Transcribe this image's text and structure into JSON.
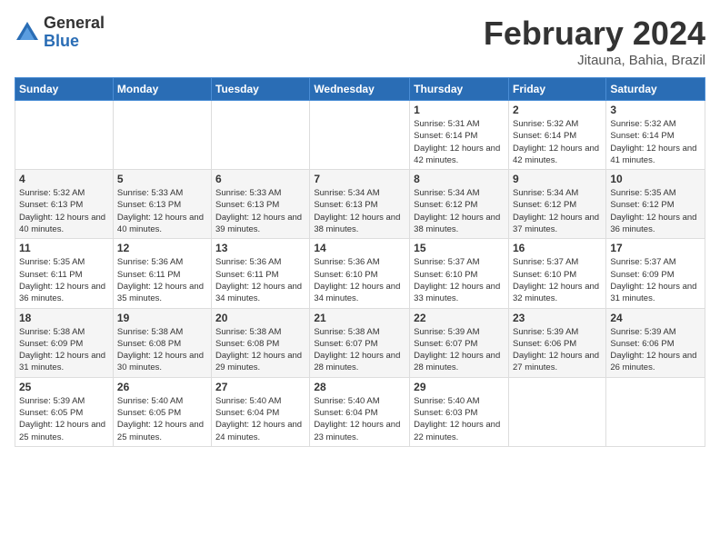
{
  "logo": {
    "general": "General",
    "blue": "Blue"
  },
  "title": "February 2024",
  "location": "Jitauna, Bahia, Brazil",
  "weekdays": [
    "Sunday",
    "Monday",
    "Tuesday",
    "Wednesday",
    "Thursday",
    "Friday",
    "Saturday"
  ],
  "weeks": [
    [
      {
        "day": "",
        "sunrise": "",
        "sunset": "",
        "daylight": ""
      },
      {
        "day": "",
        "sunrise": "",
        "sunset": "",
        "daylight": ""
      },
      {
        "day": "",
        "sunrise": "",
        "sunset": "",
        "daylight": ""
      },
      {
        "day": "",
        "sunrise": "",
        "sunset": "",
        "daylight": ""
      },
      {
        "day": "1",
        "sunrise": "Sunrise: 5:31 AM",
        "sunset": "Sunset: 6:14 PM",
        "daylight": "Daylight: 12 hours and 42 minutes."
      },
      {
        "day": "2",
        "sunrise": "Sunrise: 5:32 AM",
        "sunset": "Sunset: 6:14 PM",
        "daylight": "Daylight: 12 hours and 42 minutes."
      },
      {
        "day": "3",
        "sunrise": "Sunrise: 5:32 AM",
        "sunset": "Sunset: 6:14 PM",
        "daylight": "Daylight: 12 hours and 41 minutes."
      }
    ],
    [
      {
        "day": "4",
        "sunrise": "Sunrise: 5:32 AM",
        "sunset": "Sunset: 6:13 PM",
        "daylight": "Daylight: 12 hours and 40 minutes."
      },
      {
        "day": "5",
        "sunrise": "Sunrise: 5:33 AM",
        "sunset": "Sunset: 6:13 PM",
        "daylight": "Daylight: 12 hours and 40 minutes."
      },
      {
        "day": "6",
        "sunrise": "Sunrise: 5:33 AM",
        "sunset": "Sunset: 6:13 PM",
        "daylight": "Daylight: 12 hours and 39 minutes."
      },
      {
        "day": "7",
        "sunrise": "Sunrise: 5:34 AM",
        "sunset": "Sunset: 6:13 PM",
        "daylight": "Daylight: 12 hours and 38 minutes."
      },
      {
        "day": "8",
        "sunrise": "Sunrise: 5:34 AM",
        "sunset": "Sunset: 6:12 PM",
        "daylight": "Daylight: 12 hours and 38 minutes."
      },
      {
        "day": "9",
        "sunrise": "Sunrise: 5:34 AM",
        "sunset": "Sunset: 6:12 PM",
        "daylight": "Daylight: 12 hours and 37 minutes."
      },
      {
        "day": "10",
        "sunrise": "Sunrise: 5:35 AM",
        "sunset": "Sunset: 6:12 PM",
        "daylight": "Daylight: 12 hours and 36 minutes."
      }
    ],
    [
      {
        "day": "11",
        "sunrise": "Sunrise: 5:35 AM",
        "sunset": "Sunset: 6:11 PM",
        "daylight": "Daylight: 12 hours and 36 minutes."
      },
      {
        "day": "12",
        "sunrise": "Sunrise: 5:36 AM",
        "sunset": "Sunset: 6:11 PM",
        "daylight": "Daylight: 12 hours and 35 minutes."
      },
      {
        "day": "13",
        "sunrise": "Sunrise: 5:36 AM",
        "sunset": "Sunset: 6:11 PM",
        "daylight": "Daylight: 12 hours and 34 minutes."
      },
      {
        "day": "14",
        "sunrise": "Sunrise: 5:36 AM",
        "sunset": "Sunset: 6:10 PM",
        "daylight": "Daylight: 12 hours and 34 minutes."
      },
      {
        "day": "15",
        "sunrise": "Sunrise: 5:37 AM",
        "sunset": "Sunset: 6:10 PM",
        "daylight": "Daylight: 12 hours and 33 minutes."
      },
      {
        "day": "16",
        "sunrise": "Sunrise: 5:37 AM",
        "sunset": "Sunset: 6:10 PM",
        "daylight": "Daylight: 12 hours and 32 minutes."
      },
      {
        "day": "17",
        "sunrise": "Sunrise: 5:37 AM",
        "sunset": "Sunset: 6:09 PM",
        "daylight": "Daylight: 12 hours and 31 minutes."
      }
    ],
    [
      {
        "day": "18",
        "sunrise": "Sunrise: 5:38 AM",
        "sunset": "Sunset: 6:09 PM",
        "daylight": "Daylight: 12 hours and 31 minutes."
      },
      {
        "day": "19",
        "sunrise": "Sunrise: 5:38 AM",
        "sunset": "Sunset: 6:08 PM",
        "daylight": "Daylight: 12 hours and 30 minutes."
      },
      {
        "day": "20",
        "sunrise": "Sunrise: 5:38 AM",
        "sunset": "Sunset: 6:08 PM",
        "daylight": "Daylight: 12 hours and 29 minutes."
      },
      {
        "day": "21",
        "sunrise": "Sunrise: 5:38 AM",
        "sunset": "Sunset: 6:07 PM",
        "daylight": "Daylight: 12 hours and 28 minutes."
      },
      {
        "day": "22",
        "sunrise": "Sunrise: 5:39 AM",
        "sunset": "Sunset: 6:07 PM",
        "daylight": "Daylight: 12 hours and 28 minutes."
      },
      {
        "day": "23",
        "sunrise": "Sunrise: 5:39 AM",
        "sunset": "Sunset: 6:06 PM",
        "daylight": "Daylight: 12 hours and 27 minutes."
      },
      {
        "day": "24",
        "sunrise": "Sunrise: 5:39 AM",
        "sunset": "Sunset: 6:06 PM",
        "daylight": "Daylight: 12 hours and 26 minutes."
      }
    ],
    [
      {
        "day": "25",
        "sunrise": "Sunrise: 5:39 AM",
        "sunset": "Sunset: 6:05 PM",
        "daylight": "Daylight: 12 hours and 25 minutes."
      },
      {
        "day": "26",
        "sunrise": "Sunrise: 5:40 AM",
        "sunset": "Sunset: 6:05 PM",
        "daylight": "Daylight: 12 hours and 25 minutes."
      },
      {
        "day": "27",
        "sunrise": "Sunrise: 5:40 AM",
        "sunset": "Sunset: 6:04 PM",
        "daylight": "Daylight: 12 hours and 24 minutes."
      },
      {
        "day": "28",
        "sunrise": "Sunrise: 5:40 AM",
        "sunset": "Sunset: 6:04 PM",
        "daylight": "Daylight: 12 hours and 23 minutes."
      },
      {
        "day": "29",
        "sunrise": "Sunrise: 5:40 AM",
        "sunset": "Sunset: 6:03 PM",
        "daylight": "Daylight: 12 hours and 22 minutes."
      },
      {
        "day": "",
        "sunrise": "",
        "sunset": "",
        "daylight": ""
      },
      {
        "day": "",
        "sunrise": "",
        "sunset": "",
        "daylight": ""
      }
    ]
  ]
}
